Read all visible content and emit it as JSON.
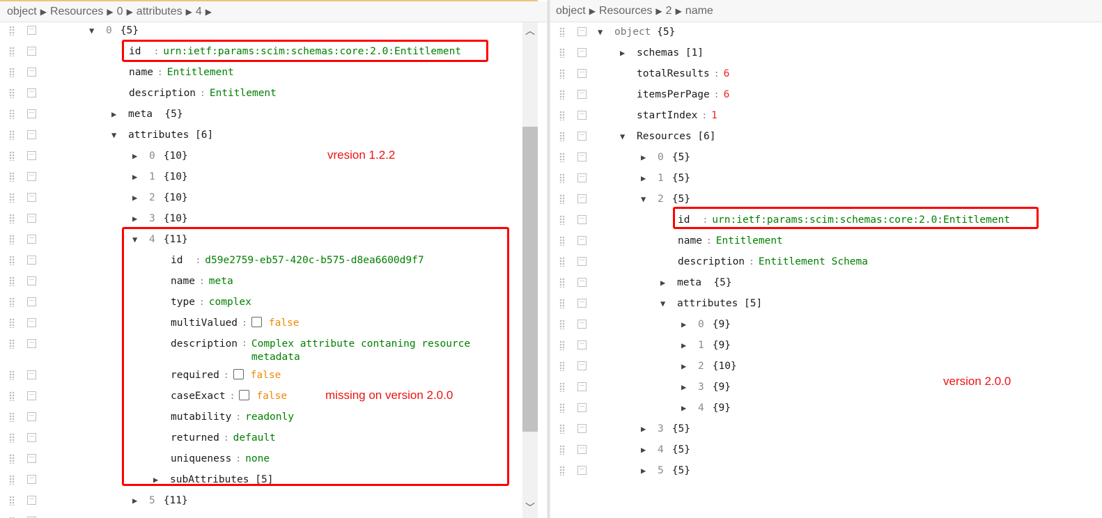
{
  "left": {
    "breadcrumb": [
      "object",
      "Resources",
      "0",
      "attributes",
      "4"
    ],
    "rows": {
      "r0_idx": "0",
      "r0_count": "{5}",
      "id_key": "id",
      "id_val": "urn:ietf:params:scim:schemas:core:2.0:Entitlement",
      "name_key": "name",
      "name_val": "Entitlement",
      "desc_key": "description",
      "desc_val": "Entitlement",
      "meta_key": "meta",
      "meta_count": "{5}",
      "attr_key": "attributes",
      "attr_count": "[6]",
      "a0_idx": "0",
      "a0_count": "{10}",
      "a1_idx": "1",
      "a1_count": "{10}",
      "a2_idx": "2",
      "a2_count": "{10}",
      "a3_idx": "3",
      "a3_count": "{10}",
      "a4_idx": "4",
      "a4_count": "{11}",
      "a4_id_key": "id",
      "a4_id_val": "d59e2759-eb57-420c-b575-d8ea6600d9f7",
      "a4_name_key": "name",
      "a4_name_val": "meta",
      "a4_type_key": "type",
      "a4_type_val": "complex",
      "a4_multi_key": "multiValued",
      "a4_multi_val": "false",
      "a4_desc_key": "description",
      "a4_desc_val1": "Complex attribute contaning resource",
      "a4_desc_val2": "metadata",
      "a4_req_key": "required",
      "a4_req_val": "false",
      "a4_case_key": "caseExact",
      "a4_case_val": "false",
      "a4_mut_key": "mutability",
      "a4_mut_val": "readonly",
      "a4_ret_key": "returned",
      "a4_ret_val": "default",
      "a4_uniq_key": "uniqueness",
      "a4_uniq_val": "none",
      "a4_sub_key": "subAttributes",
      "a4_sub_count": "[5]",
      "a5_idx": "5",
      "a5_count": "{11}"
    },
    "annotations": {
      "version": "vresion 1.2.2",
      "missing": "missing on version 2.0.0"
    }
  },
  "right": {
    "breadcrumb": [
      "object",
      "Resources",
      "2",
      "name"
    ],
    "rows": {
      "root_key": "object",
      "root_count": "{5}",
      "schemas_key": "schemas",
      "schemas_count": "[1]",
      "total_key": "totalResults",
      "total_val": "6",
      "ipp_key": "itemsPerPage",
      "ipp_val": "6",
      "start_key": "startIndex",
      "start_val": "1",
      "res_key": "Resources",
      "res_count": "[6]",
      "r0_idx": "0",
      "r0_count": "{5}",
      "r1_idx": "1",
      "r1_count": "{5}",
      "r2_idx": "2",
      "r2_count": "{5}",
      "id_key": "id",
      "id_val": "urn:ietf:params:scim:schemas:core:2.0:Entitlement",
      "name_key": "name",
      "name_val": "Entitlement",
      "desc_key": "description",
      "desc_val": "Entitlement Schema",
      "meta_key": "meta",
      "meta_count": "{5}",
      "attr_key": "attributes",
      "attr_count": "[5]",
      "a0_idx": "0",
      "a0_count": "{9}",
      "a1_idx": "1",
      "a1_count": "{9}",
      "a2_idx": "2",
      "a2_count": "{10}",
      "a3_idx": "3",
      "a3_count": "{9}",
      "a4_idx": "4",
      "a4_count": "{9}",
      "r3_idx": "3",
      "r3_count": "{5}",
      "r4_idx": "4",
      "r4_count": "{5}",
      "r5_idx": "5",
      "r5_count": "{5}"
    },
    "annotations": {
      "version": "version 2.0.0"
    }
  },
  "icons": {
    "collapsed": "triangle-right-icon",
    "expanded": "triangle-down-icon",
    "drag": "drag-handle-icon",
    "row_menu": "row-menu-icon"
  },
  "colors": {
    "string": "#008000",
    "number": "#ee2222",
    "boolean": "#ee8800",
    "annotation": "#ee1111",
    "highlight_box": "#ff0000"
  }
}
